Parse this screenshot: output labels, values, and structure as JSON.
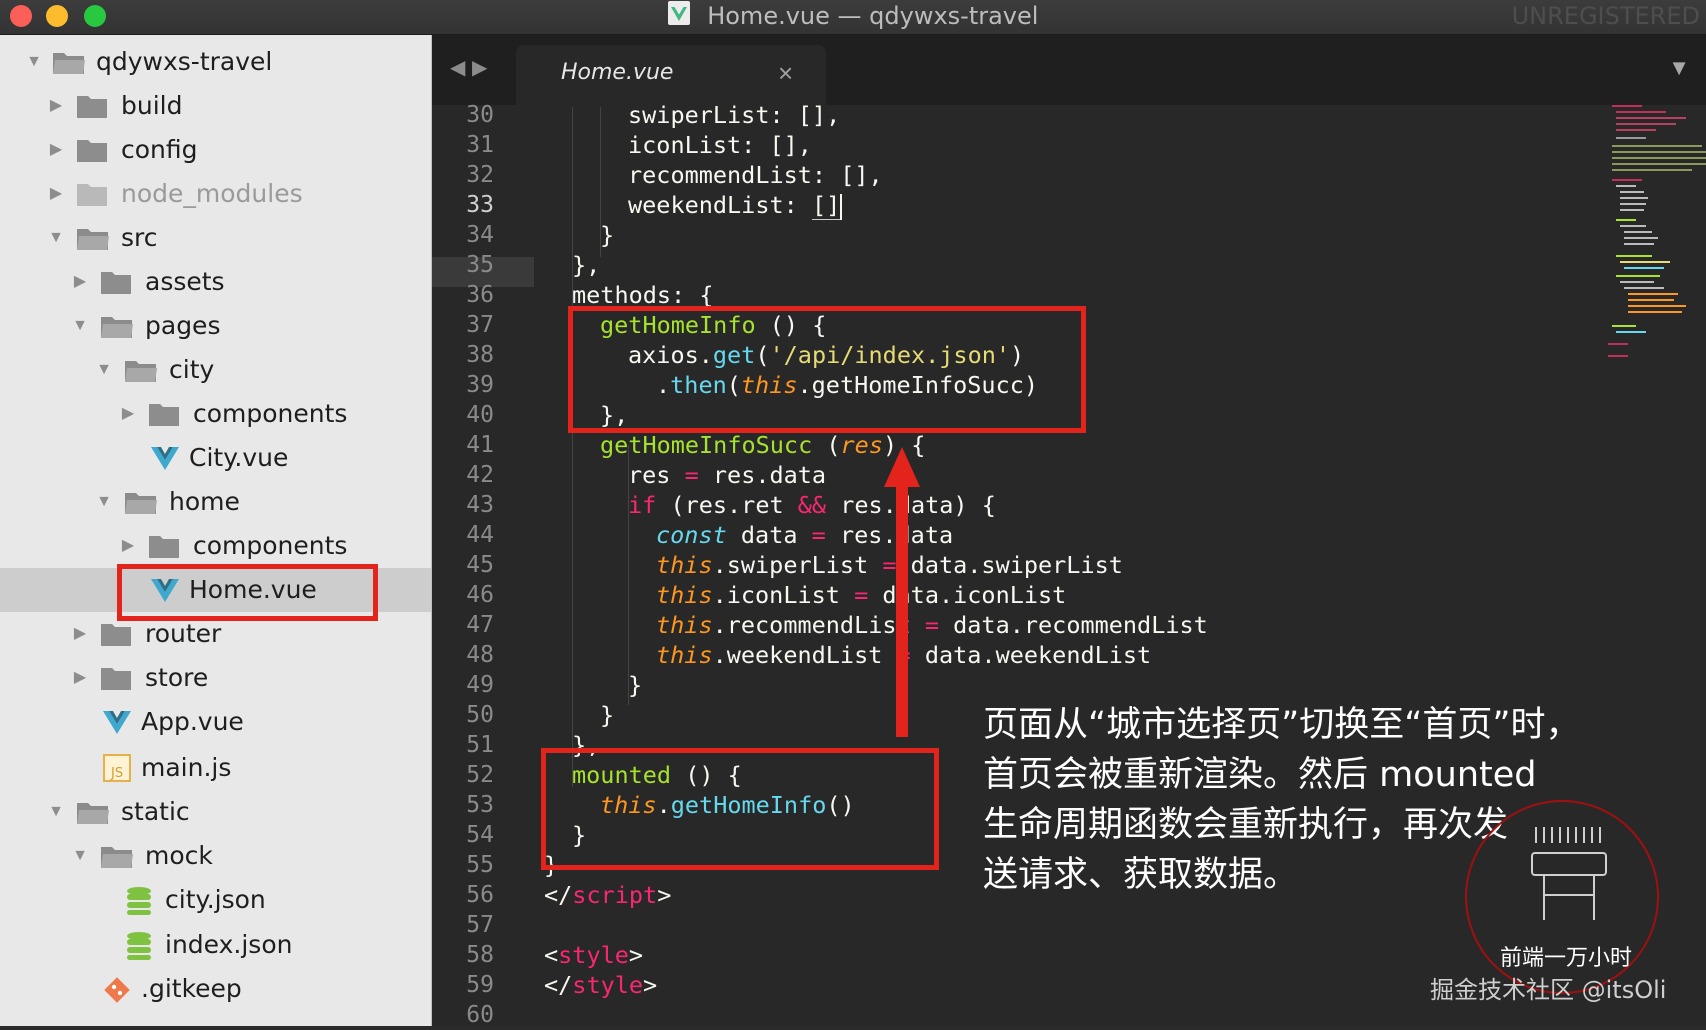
{
  "window": {
    "title": "Home.vue — qdywxs-travel",
    "badge": "UNREGISTERED"
  },
  "sidebar": {
    "items": [
      {
        "label": "qdywxs-travel",
        "kind": "folder",
        "state": "open"
      },
      {
        "label": "build",
        "kind": "folder",
        "state": "closed"
      },
      {
        "label": "config",
        "kind": "folder",
        "state": "closed"
      },
      {
        "label": "node_modules",
        "kind": "folder",
        "state": "closed"
      },
      {
        "label": "src",
        "kind": "folder",
        "state": "open"
      },
      {
        "label": "assets",
        "kind": "folder",
        "state": "closed"
      },
      {
        "label": "pages",
        "kind": "folder",
        "state": "open"
      },
      {
        "label": "city",
        "kind": "folder",
        "state": "open"
      },
      {
        "label": "components",
        "kind": "folder",
        "state": "closed"
      },
      {
        "label": "City.vue",
        "kind": "vue-file"
      },
      {
        "label": "home",
        "kind": "folder",
        "state": "open"
      },
      {
        "label": "components",
        "kind": "folder",
        "state": "closed"
      },
      {
        "label": "Home.vue",
        "kind": "vue-file",
        "selected": true
      },
      {
        "label": "router",
        "kind": "folder",
        "state": "closed"
      },
      {
        "label": "store",
        "kind": "folder",
        "state": "closed"
      },
      {
        "label": "App.vue",
        "kind": "vue-file"
      },
      {
        "label": "main.js",
        "kind": "js-file"
      },
      {
        "label": "static",
        "kind": "folder",
        "state": "open"
      },
      {
        "label": "mock",
        "kind": "folder",
        "state": "open"
      },
      {
        "label": "city.json",
        "kind": "json-file"
      },
      {
        "label": "index.json",
        "kind": "json-file"
      },
      {
        "label": ".gitkeep",
        "kind": "git-file"
      }
    ]
  },
  "editor": {
    "tab": {
      "name": "Home.vue",
      "close": "×"
    },
    "nav_back": "◀",
    "nav_forward": "▶",
    "tab_menu": "▼",
    "line_numbers": [
      "30",
      "31",
      "32",
      "33",
      "34",
      "35",
      "36",
      "37",
      "38",
      "39",
      "40",
      "41",
      "42",
      "43",
      "44",
      "45",
      "46",
      "47",
      "48",
      "49",
      "50",
      "51",
      "52",
      "53",
      "54",
      "55",
      "56",
      "57",
      "58",
      "59",
      "60"
    ],
    "current_line": "33",
    "code": {
      "l30a": "swiperList: [],",
      "l31a": "iconList: [],",
      "l32a": "recommendList: [],",
      "l33a": "weekendList: ",
      "l33b": "[]",
      "l34a": "}",
      "l35a": "},",
      "l36a": "methods: {",
      "l37a": "getHomeInfo",
      "l37b": " () {",
      "l38a": "axios.",
      "l38b": "get",
      "l38c": "(",
      "l38d": "'/api/index.json'",
      "l38e": ")",
      "l39a": ".",
      "l39b": "then",
      "l39c": "(",
      "l39d": "this",
      "l39e": ".getHomeInfoSucc)",
      "l40a": "},",
      "l41a": "getHomeInfoSucc",
      "l41b": " (",
      "l41c": "res",
      "l41d": ") {",
      "l42a": "res ",
      "l42b": "=",
      "l42c": " res.data",
      "l43a": "if",
      "l43b": " (res.ret ",
      "l43c": "&&",
      "l43d": " res.data) {",
      "l44a": "const",
      "l44b": " data ",
      "l44c": "=",
      "l44d": " res.data",
      "l45a": "this",
      "l45b": ".swiperList ",
      "l45c": "=",
      "l45d": " data.swiperList",
      "l46a": "this",
      "l46b": ".iconList ",
      "l46c": "=",
      "l46d": " data.iconList",
      "l47a": "this",
      "l47b": ".recommendList ",
      "l47c": "=",
      "l47d": " data.recommendList",
      "l48a": "this",
      "l48b": ".weekendList ",
      "l48c": "=",
      "l48d": " data.weekendList",
      "l49a": "}",
      "l50a": "}",
      "l51a": "},",
      "l52a": "mounted",
      "l52b": " () {",
      "l53a": "this",
      "l53b": ".",
      "l53c": "getHomeInfo",
      "l53d": "()",
      "l54a": "}",
      "l55a": "}",
      "l56a": "</",
      "l56b": "script",
      "l56c": ">",
      "l58a": "<",
      "l58b": "style",
      "l58c": ">",
      "l59a": "</",
      "l59b": "style",
      "l59c": ">"
    }
  },
  "annotation": {
    "line1": "页面从“城市选择页”切换至“首页”时，",
    "line2": "首页会被重新渲染。然后 mounted",
    "line3": "生命周期函数会重新执行，再次发",
    "line4": "送请求、获取数据。"
  },
  "watermark": {
    "line1": "前端一万小时",
    "line2": "掘金技术社区 @itsOli"
  },
  "colors": {
    "highlight_box": "#e3241d",
    "editor_bg": "#282828",
    "sidebar_bg": "#e8e8e8"
  }
}
